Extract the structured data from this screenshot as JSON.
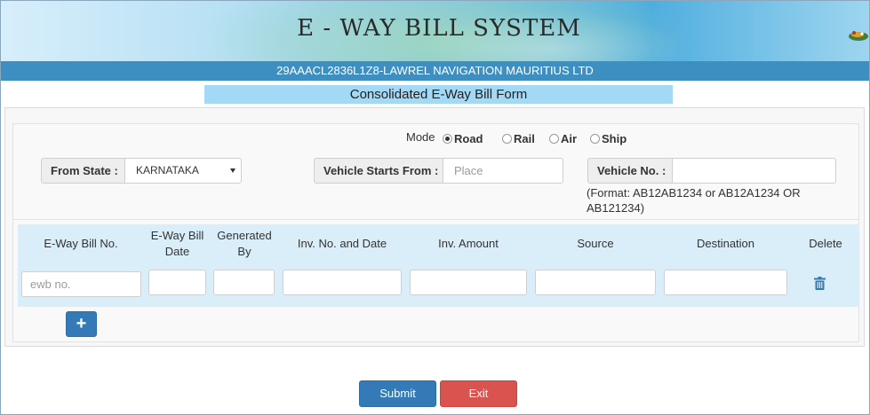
{
  "header": {
    "title": "E - WAY BILL SYSTEM",
    "gstin_name": "29AAACL2836L1Z8-LAWREL NAVIGATION MAURITIUS LTD",
    "form_title": "Consolidated E-Way Bill Form"
  },
  "mode": {
    "label": "Mode",
    "options": [
      "Road",
      "Rail",
      "Air",
      "Ship"
    ],
    "selected": "Road"
  },
  "from_state": {
    "label": "From State :",
    "value": "KARNATAKA"
  },
  "vehicle_starts_from": {
    "label": "Vehicle Starts From :",
    "placeholder": "Place"
  },
  "vehicle_no": {
    "label": "Vehicle No. :",
    "value": "",
    "format_hint": "(Format: AB12AB1234 or AB12A1234 OR AB121234)"
  },
  "table": {
    "columns": [
      "E-Way Bill No.",
      "E-Way Bill Date",
      "Generated By",
      "Inv. No. and Date",
      "Inv. Amount",
      "Source",
      "Destination",
      "Delete"
    ],
    "ewb_placeholder": "ewb no."
  },
  "buttons": {
    "add": "+",
    "submit": "Submit",
    "exit": "Exit"
  },
  "colors": {
    "header_bar": "#3d8fc2",
    "form_title_bg": "#a3d9f5",
    "grid_bg": "#d9eef9",
    "primary": "#337ab7",
    "danger": "#d9534f"
  },
  "icons": [
    "national-emblem-icon",
    "trash-icon"
  ]
}
